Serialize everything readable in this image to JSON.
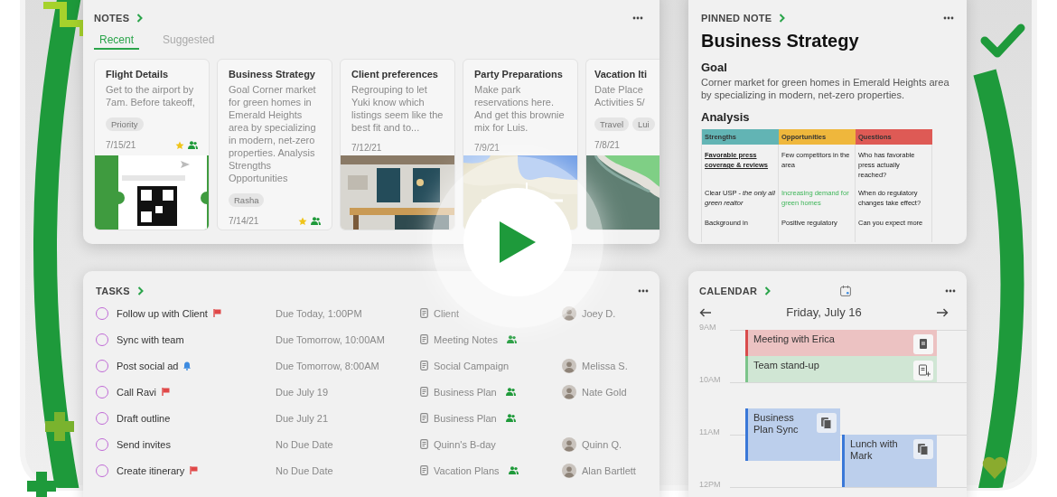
{
  "notes": {
    "title": "NOTES",
    "tabs": [
      {
        "label": "Recent",
        "selected": true
      },
      {
        "label": "Suggested",
        "selected": false
      }
    ],
    "cards": [
      {
        "title": "Flight Details",
        "body": "Get to the airport by 7am. Before takeoff,",
        "tags": [
          "Priority"
        ],
        "date": "7/15/21",
        "starred": true,
        "shared": true,
        "image": {
          "kind": "picture"
        }
      },
      {
        "title": "Business Strategy",
        "body": "Goal Corner market for green homes in Emerald Heights area by specializing in modern, net-zero properties. Analysis Strengths Opportunities",
        "tags": [
          "Rasha"
        ],
        "date": "7/14/21",
        "starred": true,
        "shared": true
      },
      {
        "title": "Client preferences",
        "body": "Regrouping to let Yuki know which listings seem like the best fit and to...",
        "date": "7/12/21",
        "starred": false,
        "shared": false,
        "image": {
          "kind": "picture"
        }
      },
      {
        "title": "Party Preparations",
        "body": "Make park reservations here. And get this brownie mix for Luis.",
        "date": "7/9/21",
        "starred": false,
        "shared": false,
        "image": {
          "kind": "picture"
        }
      },
      {
        "title": "Vacation Iti",
        "body": "Date Place\nActivities 5/",
        "tags": [
          "Travel",
          "Lui"
        ],
        "date": "7/8/21",
        "starred": false,
        "shared": false,
        "image": {
          "kind": "picture"
        }
      }
    ]
  },
  "pinned_note": {
    "title": "PINNED NOTE",
    "heading": "Business Strategy",
    "goal_heading": "Goal",
    "goal": "Corner market for green homes in Emerald Heights area by specializing in modern, net-zero properties.",
    "analysis_heading": "Analysis",
    "table": {
      "columns": [
        {
          "label": "Strengths",
          "color": "#62b4b4"
        },
        {
          "label": "Opportunities",
          "color": "#efb73c"
        },
        {
          "label": "Questions",
          "color": "#de5a55"
        }
      ],
      "rows": [
        [
          {
            "text": "Favorable press coverage & reviews",
            "kind": "emphasis"
          },
          {
            "text": "Few competitors in the area",
            "kind": "plain"
          },
          {
            "text": "Who has favorable press actually reached?",
            "kind": "plain"
          }
        ],
        [
          {
            "text": "Clear USP - *the only all green realtor*",
            "kind": "plain"
          },
          {
            "text": "Increasing demand for green homes",
            "kind": "highlight"
          },
          {
            "text": "When do regulatory changes take effect?",
            "kind": "plain"
          }
        ],
        [
          {
            "text": "Background in",
            "kind": "plain"
          },
          {
            "text": "Positive regulatory",
            "kind": "plain"
          },
          {
            "text": "Can you expect more",
            "kind": "plain"
          }
        ]
      ]
    }
  },
  "tasks": {
    "title": "TASKS",
    "rows": [
      {
        "checked": false,
        "title": "Follow up with Client",
        "flagged": true,
        "reminder": false,
        "due": "Due Today, 1:00PM",
        "note": "Client",
        "shared": false,
        "assignee": "Joey D."
      },
      {
        "checked": false,
        "title": "Sync with team",
        "flagged": false,
        "reminder": false,
        "due": "Due Tomorrow, 10:00AM",
        "note": "Meeting Notes",
        "shared": true
      },
      {
        "checked": false,
        "title": "Post social ad",
        "flagged": false,
        "reminder": true,
        "due": "Due Tomorrow, 8:00AM",
        "note": "Social Campaign",
        "shared": false,
        "assignee": "Melissa S."
      },
      {
        "checked": false,
        "title": "Call Ravi",
        "flagged": true,
        "reminder": false,
        "due": "Due July 19",
        "note": "Business Plan",
        "shared": true,
        "assignee": "Nate Gold"
      },
      {
        "checked": false,
        "title": "Draft outline",
        "flagged": false,
        "reminder": false,
        "due": "Due July 21",
        "note": "Business Plan",
        "shared": true
      },
      {
        "checked": false,
        "title": "Send invites",
        "flagged": false,
        "reminder": false,
        "due": "No Due Date",
        "note": "Quinn's B-day",
        "shared": false,
        "assignee": "Quinn Q."
      },
      {
        "checked": false,
        "title": "Create itinerary",
        "flagged": true,
        "reminder": false,
        "due": "No Due Date",
        "note": "Vacation Plans",
        "shared": true,
        "assignee": "Alan Bartlett"
      }
    ]
  },
  "calendar": {
    "title": "CALENDAR",
    "date": "Friday, July 16",
    "hours": [
      "9AM",
      "10AM",
      "11AM",
      "12PM"
    ],
    "events": [
      {
        "title": "Meeting with Erica",
        "color": "#d94c4c",
        "kind": "note"
      },
      {
        "title": "Team stand-up",
        "color": "#7cc48a",
        "kind": "add-note"
      },
      {
        "title": "Business Plan Sync",
        "color": "#3a78d8",
        "kind": "notes"
      },
      {
        "title": "Lunch with Mark",
        "color": "#3a78d8",
        "kind": "notes"
      }
    ]
  }
}
